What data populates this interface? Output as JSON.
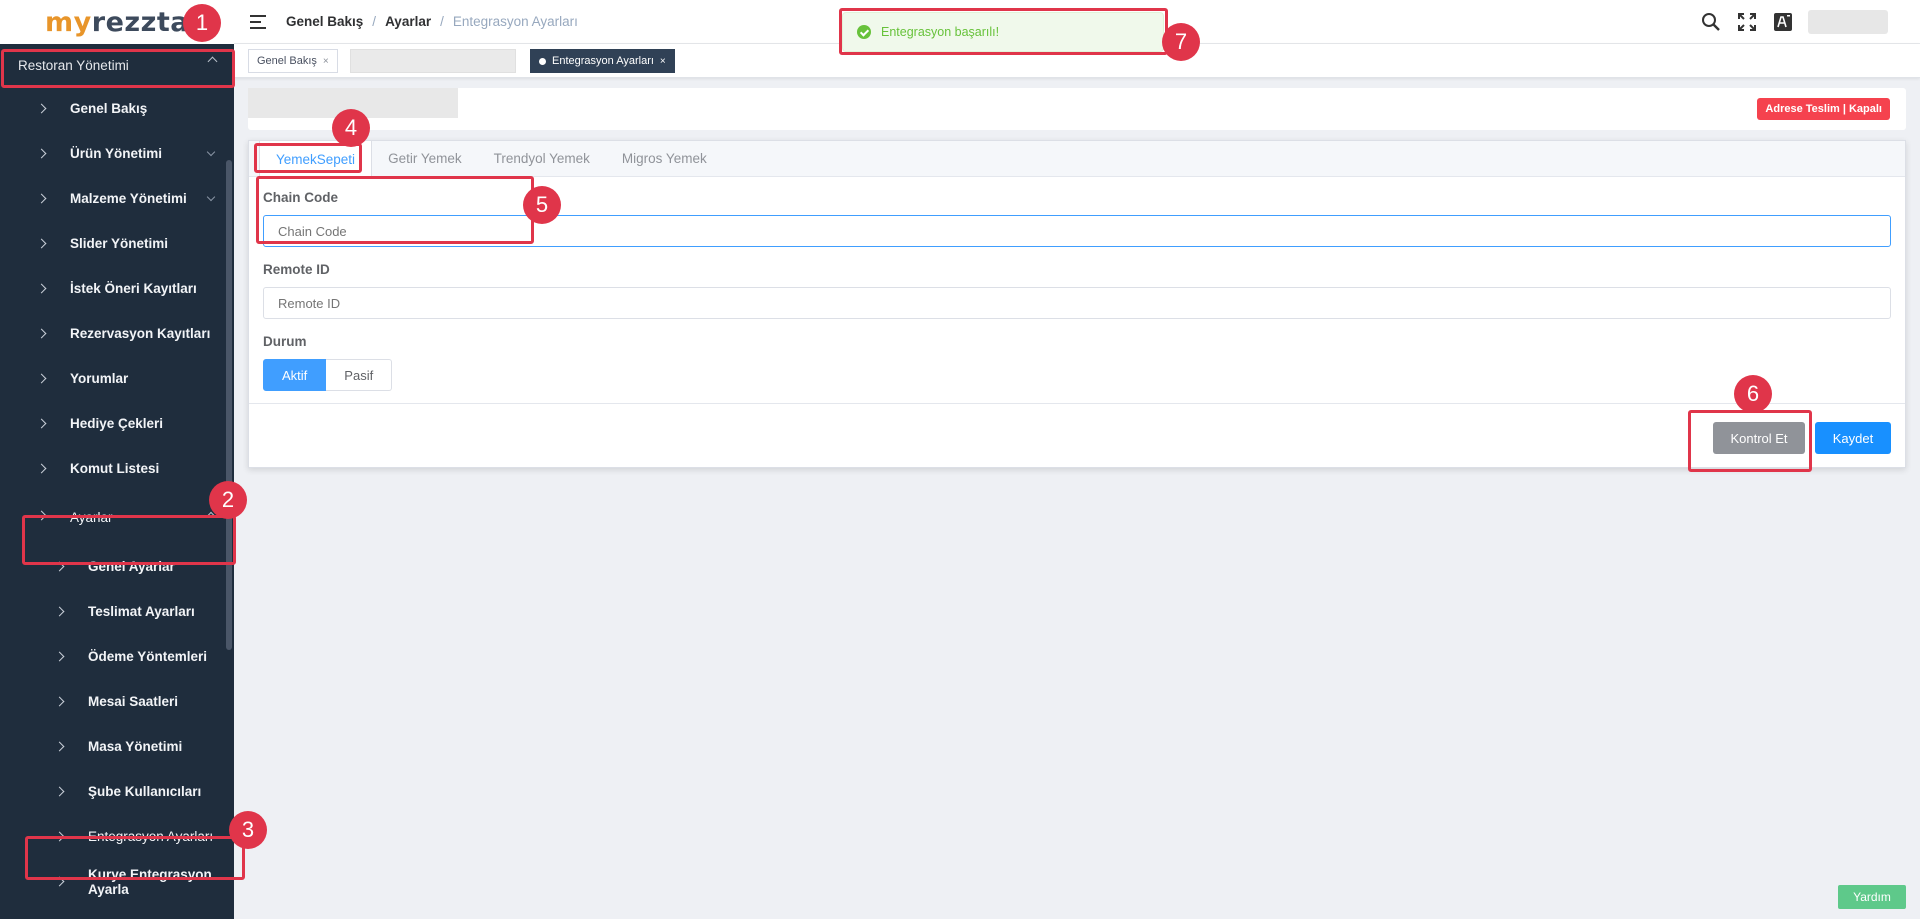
{
  "app": {
    "logo_prefix": "my",
    "logo_rest": "rezzta"
  },
  "sidebar": {
    "group": "Restoran Yönetimi",
    "items": [
      {
        "label": "Genel Bakış"
      },
      {
        "label": "Ürün Yönetimi"
      },
      {
        "label": "Malzeme Yönetimi"
      },
      {
        "label": "Slider Yönetimi"
      },
      {
        "label": "İstek Öneri Kayıtları"
      },
      {
        "label": "Rezervasyon Kayıtları"
      },
      {
        "label": "Yorumlar"
      },
      {
        "label": "Hediye Çekleri"
      },
      {
        "label": "Komut Listesi"
      },
      {
        "label": "Ayarlar"
      }
    ],
    "settings_items": [
      {
        "label": "Genel Ayarlar"
      },
      {
        "label": "Teslimat Ayarları"
      },
      {
        "label": "Ödeme Yöntemleri"
      },
      {
        "label": "Mesai Saatleri"
      },
      {
        "label": "Masa Yönetimi"
      },
      {
        "label": "Şube Kullanıcıları"
      },
      {
        "label": "Entegrasyon Ayarları"
      },
      {
        "label": "Kurye Entegrasyon Ayarla"
      }
    ]
  },
  "breadcrumb": {
    "home": "Genel Bakış",
    "parent": "Ayarlar",
    "current": "Entegrasyon Ayarları"
  },
  "tags": {
    "home": "Genel Bakış",
    "active": "Entegrasyon Ayarları",
    "close_glyph": "×"
  },
  "restaurant": {
    "status": "Adrese Teslim | Kapalı"
  },
  "tabs": [
    {
      "label": "YemekSepeti"
    },
    {
      "label": "Getir Yemek"
    },
    {
      "label": "Trendyol Yemek"
    },
    {
      "label": "Migros Yemek"
    }
  ],
  "form": {
    "chain_code_label": "Chain Code",
    "chain_code_placeholder": "Chain Code",
    "remote_id_label": "Remote ID",
    "remote_id_placeholder": "Remote ID",
    "status_label": "Durum",
    "status_on": "Aktif",
    "status_off": "Pasif"
  },
  "actions": {
    "check": "Kontrol Et",
    "save": "Kaydet"
  },
  "toast": {
    "message": "Entegrasyon başarılı!"
  },
  "help": {
    "label": "Yardım"
  },
  "callouts": [
    "1",
    "2",
    "3",
    "4",
    "5",
    "6",
    "7"
  ],
  "colors": {
    "accent": "#409eff",
    "success": "#67c23a",
    "danger": "#f5424e",
    "callout": "#e0354a",
    "sidebar": "#1f2d3d"
  }
}
